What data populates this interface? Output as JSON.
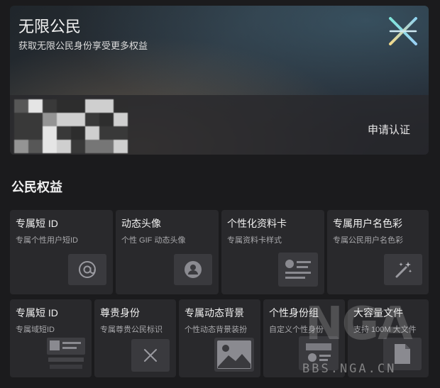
{
  "banner": {
    "title": "无限公民",
    "subtitle": "获取无限公民身份享受更多权益",
    "apply_label": "申请认证"
  },
  "section_title": "公民权益",
  "benefits_row1": [
    {
      "title": "专属短 ID",
      "desc": "专属个性用户短ID",
      "icon": "at-icon"
    },
    {
      "title": "动态头像",
      "desc": "个性 GIF 动态头像",
      "icon": "avatar-icon"
    },
    {
      "title": "个性化资料卡",
      "desc": "专属资料卡样式",
      "icon": "profile-card-icon"
    },
    {
      "title": "专属用户名色彩",
      "desc": "专属公民用户名色彩",
      "icon": "magic-wand-icon"
    }
  ],
  "benefits_row2": [
    {
      "title": "专属短 ID",
      "desc": "专属域短ID",
      "icon": "id-card-stack-icon"
    },
    {
      "title": "尊贵身份",
      "desc": "专属尊贵公民标识",
      "icon": "x-badge-icon"
    },
    {
      "title": "专属动态背景",
      "desc": "个性动态背景装扮",
      "icon": "image-icon"
    },
    {
      "title": "个性身份组",
      "desc": "自定义个性身份",
      "icon": "identity-group-icon"
    },
    {
      "title": "大容量文件",
      "desc": "支持 100M 大文件",
      "icon": "file-icon"
    }
  ],
  "watermark": {
    "logo": "NGA",
    "url": "BBS.NGA.CN"
  },
  "colors": {
    "background": "#1b1b1d",
    "card": "#29292c",
    "icon_tile": "#3a3a3e"
  }
}
